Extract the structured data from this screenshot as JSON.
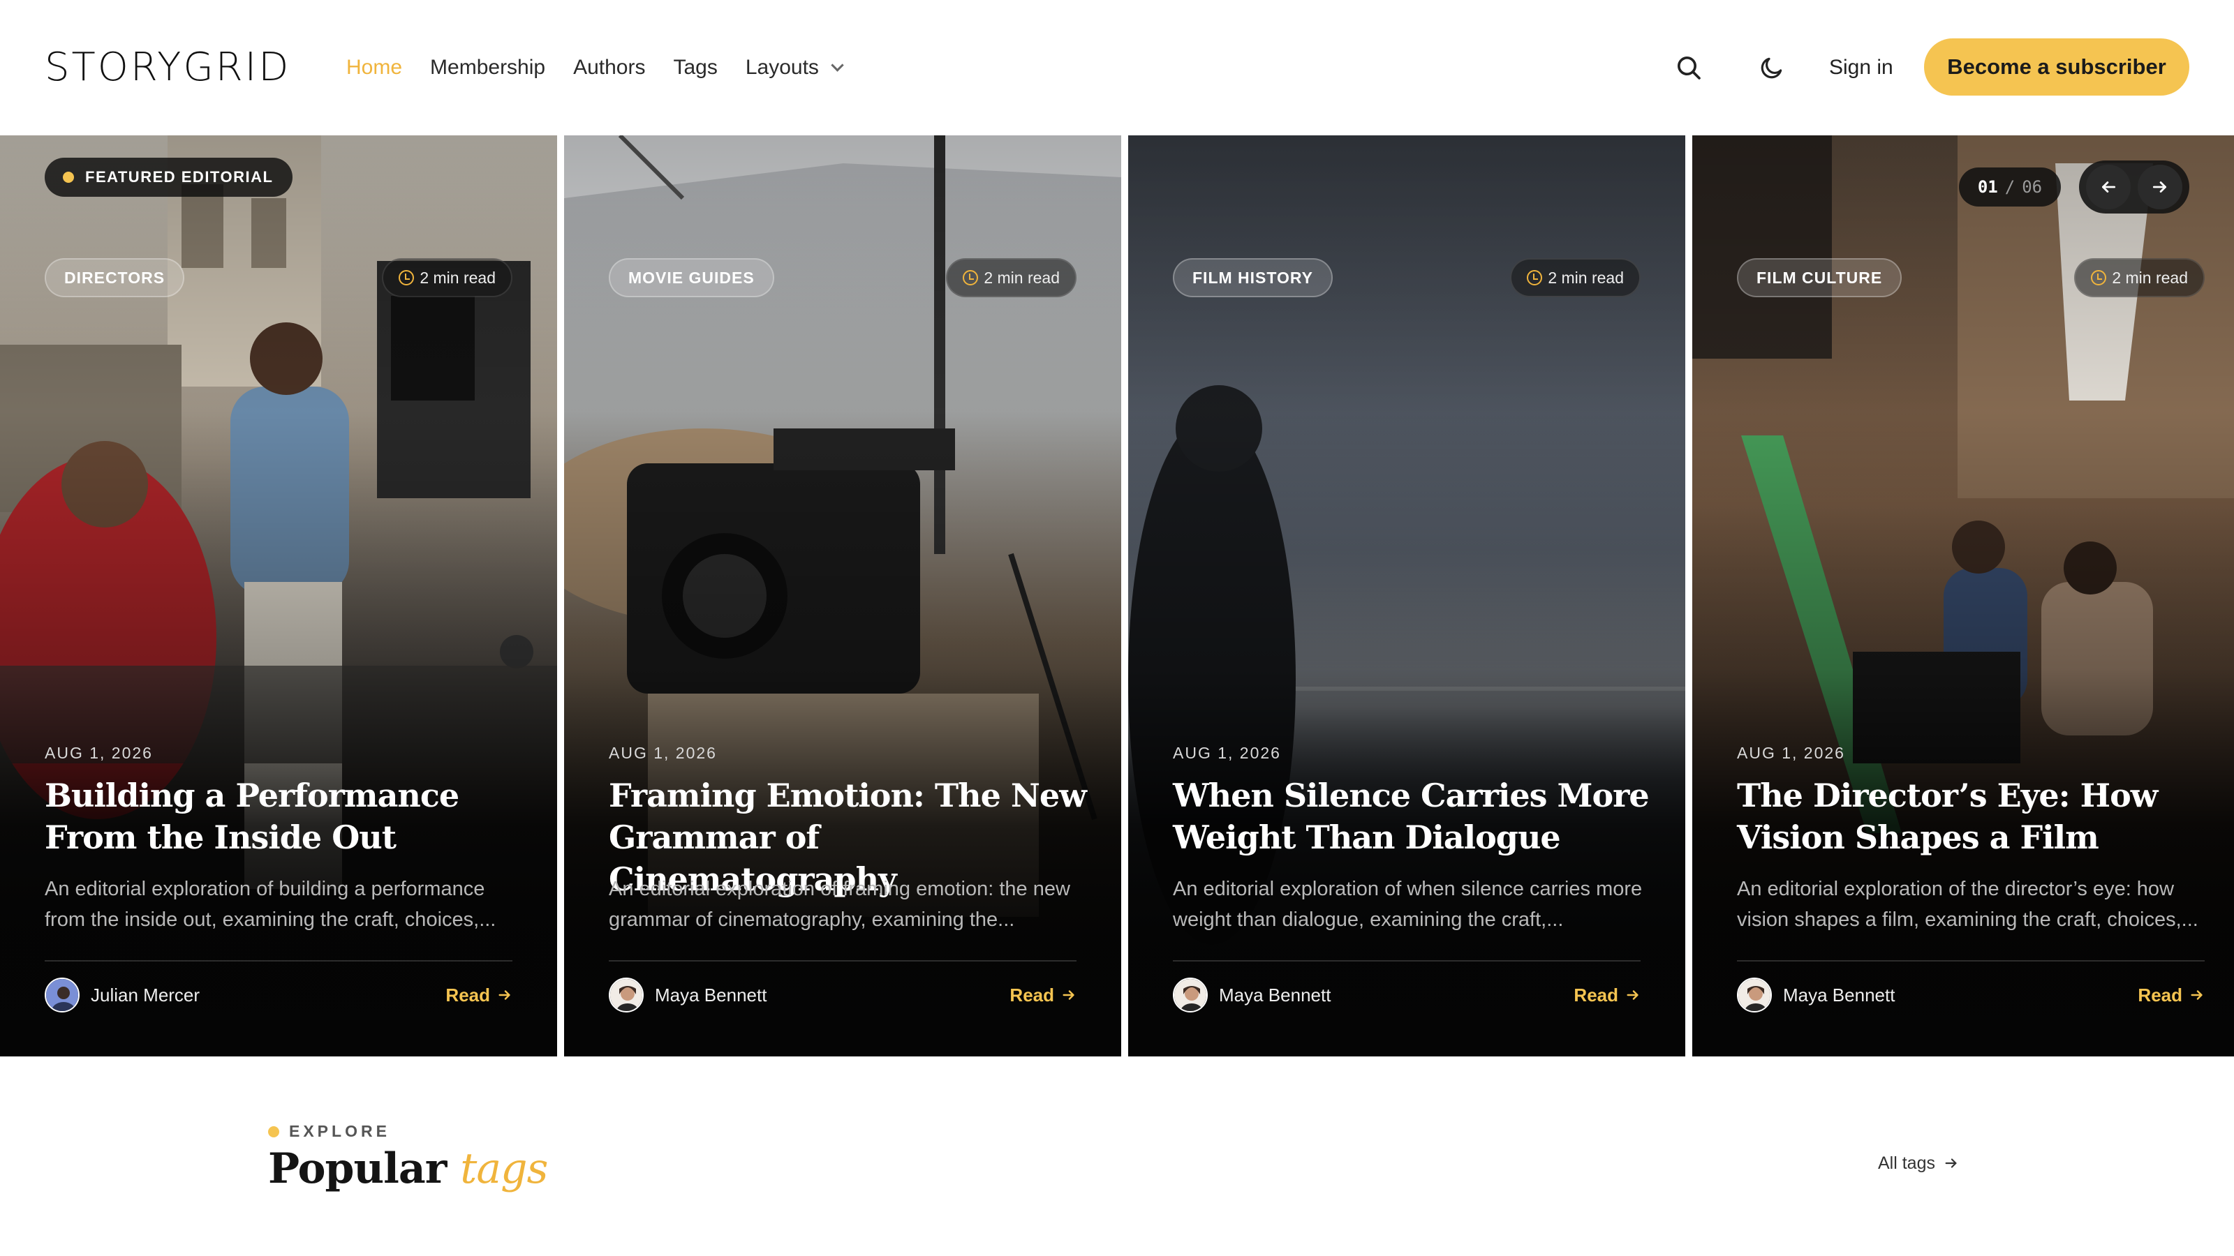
{
  "brand": {
    "logo": "STORYGRID"
  },
  "nav": {
    "items": [
      {
        "label": "Home",
        "active": true
      },
      {
        "label": "Membership"
      },
      {
        "label": "Authors"
      },
      {
        "label": "Tags"
      },
      {
        "label": "Layouts",
        "has_dropdown": true
      }
    ]
  },
  "header": {
    "search_icon": "search-icon",
    "theme_icon": "moon-icon",
    "signin_label": "Sign in",
    "subscribe_label": "Become a subscriber"
  },
  "slider": {
    "featured_label": "FEATURED EDITORIAL",
    "current": "01",
    "separator": "/",
    "total": "06"
  },
  "cards": [
    {
      "category": "DIRECTORS",
      "read_time": "2 min read",
      "date": "AUG 1, 2026",
      "title": "Building a Performance From the Inside Out",
      "excerpt": "An editorial exploration of building a performance from the inside out, examining the craft, choices,...",
      "author": "Julian Mercer",
      "read_label": "Read"
    },
    {
      "category": "MOVIE GUIDES",
      "read_time": "2 min read",
      "date": "AUG 1, 2026",
      "title": "Framing Emotion: The New Grammar of Cinematography",
      "excerpt": "An editorial exploration of framing emotion: the new grammar of cinematography, examining the...",
      "author": "Maya Bennett",
      "read_label": "Read"
    },
    {
      "category": "FILM HISTORY",
      "read_time": "2 min read",
      "date": "AUG 1, 2026",
      "title": "When Silence Carries More Weight Than Dialogue",
      "excerpt": "An editorial exploration of when silence carries more weight than dialogue, examining the craft,...",
      "author": "Maya Bennett",
      "read_label": "Read"
    },
    {
      "category": "FILM CULTURE",
      "read_time": "2 min read",
      "date": "AUG 1, 2026",
      "title": "The Director’s Eye: How Vision Shapes a Film",
      "excerpt": "An editorial exploration of the director’s eye: how vision shapes a film, examining the craft, choices,...",
      "author": "Maya Bennett",
      "read_label": "Read"
    }
  ],
  "explore": {
    "eyebrow": "EXPLORE",
    "title_main": "Popular",
    "title_accent": "tags",
    "all_tags_label": "All tags"
  },
  "colors": {
    "accent": "#f5c451",
    "active_nav": "#f0b43c",
    "text": "#161616"
  }
}
